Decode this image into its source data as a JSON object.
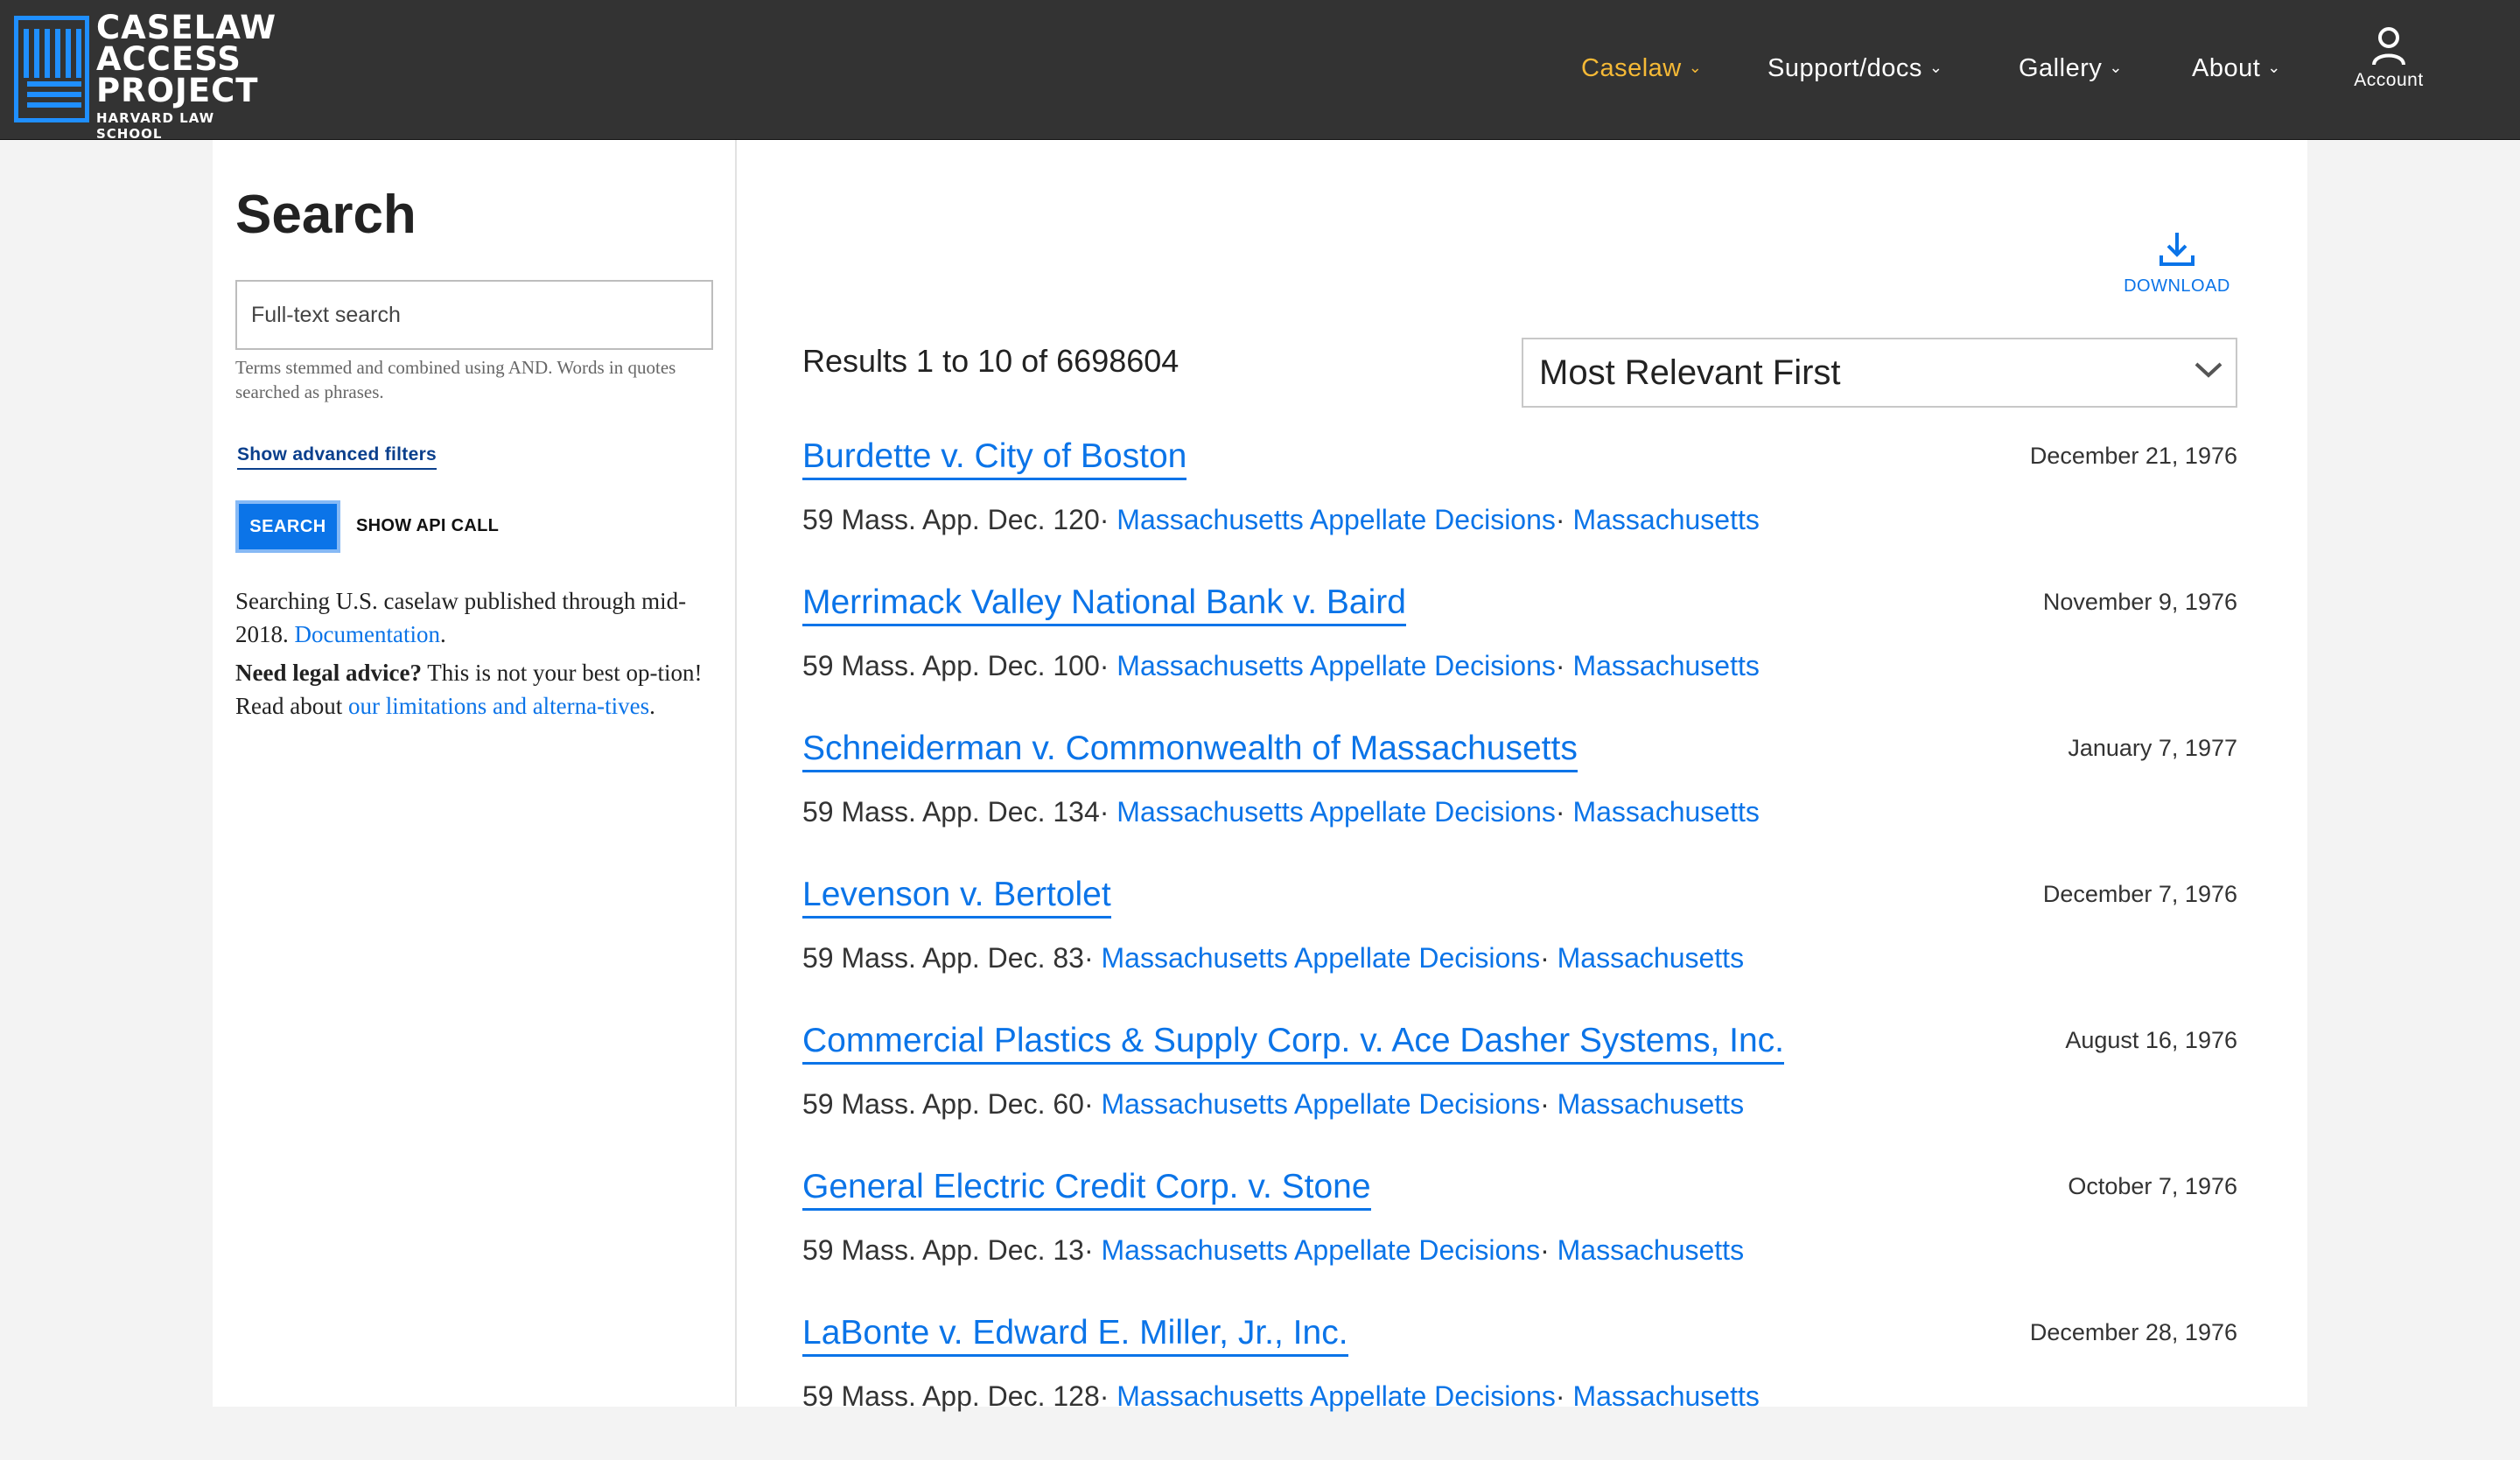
{
  "header": {
    "logo": {
      "line1": "CASELAW",
      "line2": "ACCESS",
      "line3": "PROJECT",
      "subtitle": "HARVARD LAW SCHOOL"
    },
    "nav": [
      {
        "label": "Caselaw",
        "active": true
      },
      {
        "label": "Support/docs",
        "active": false
      },
      {
        "label": "Gallery",
        "active": false
      },
      {
        "label": "About",
        "active": false
      }
    ],
    "account_label": "Account"
  },
  "sidebar": {
    "title": "Search",
    "search_placeholder": "Full-text search",
    "search_help": "Terms stemmed and combined using AND. Words in quotes searched as phrases.",
    "advanced_filters_link": "Show advanced filters",
    "search_button": "SEARCH",
    "api_call_button": "SHOW API CALL",
    "info": {
      "p1_text": "Searching U.S. caselaw published through mid-2018.",
      "p1_link": "Documentation",
      "p1_end": ".",
      "p2_bold": "Need legal advice?",
      "p2_text": "This is not your best op-tion! Read about",
      "p2_link": "our limitations and alterna-tives",
      "p2_end": "."
    }
  },
  "results": {
    "download_label": "DOWNLOAD",
    "count_text": "Results 1 to 10 of 6698604",
    "sort_selected": "Most Relevant First",
    "items": [
      {
        "name": "Burdette v. City of Boston",
        "date": "December 21, 1976",
        "citation": "59 Mass. App. Dec. 120",
        "reporter": "Massachusetts Appellate Decisions",
        "jurisdiction": "Massachusetts"
      },
      {
        "name": "Merrimack Valley National Bank v. Baird",
        "date": "November 9, 1976",
        "citation": "59 Mass. App. Dec. 100",
        "reporter": "Massachusetts Appellate Decisions",
        "jurisdiction": "Massachusetts"
      },
      {
        "name": "Schneiderman v. Commonwealth of Massachusetts",
        "date": "January 7, 1977",
        "citation": "59 Mass. App. Dec. 134",
        "reporter": "Massachusetts Appellate Decisions",
        "jurisdiction": "Massachusetts"
      },
      {
        "name": "Levenson v. Bertolet",
        "date": "December 7, 1976",
        "citation": "59 Mass. App. Dec. 83",
        "reporter": "Massachusetts Appellate Decisions",
        "jurisdiction": "Massachusetts"
      },
      {
        "name": "Commercial Plastics & Supply Corp. v. Ace Dasher Systems, Inc.",
        "date": "August 16, 1976",
        "citation": "59 Mass. App. Dec. 60",
        "reporter": "Massachusetts Appellate Decisions",
        "jurisdiction": "Massachusetts"
      },
      {
        "name": "General Electric Credit Corp. v. Stone",
        "date": "October 7, 1976",
        "citation": "59 Mass. App. Dec. 13",
        "reporter": "Massachusetts Appellate Decisions",
        "jurisdiction": "Massachusetts"
      },
      {
        "name": "LaBonte v. Edward E. Miller, Jr., Inc.",
        "date": "December 28, 1976",
        "citation": "59 Mass. App. Dec. 128",
        "reporter": "Massachusetts Appellate Decisions",
        "jurisdiction": "Massachusetts"
      }
    ]
  },
  "colors": {
    "header_bg": "#333333",
    "accent_blue": "#0b74e8",
    "nav_active": "#f5b936",
    "logo_blue": "#1f8fff"
  }
}
